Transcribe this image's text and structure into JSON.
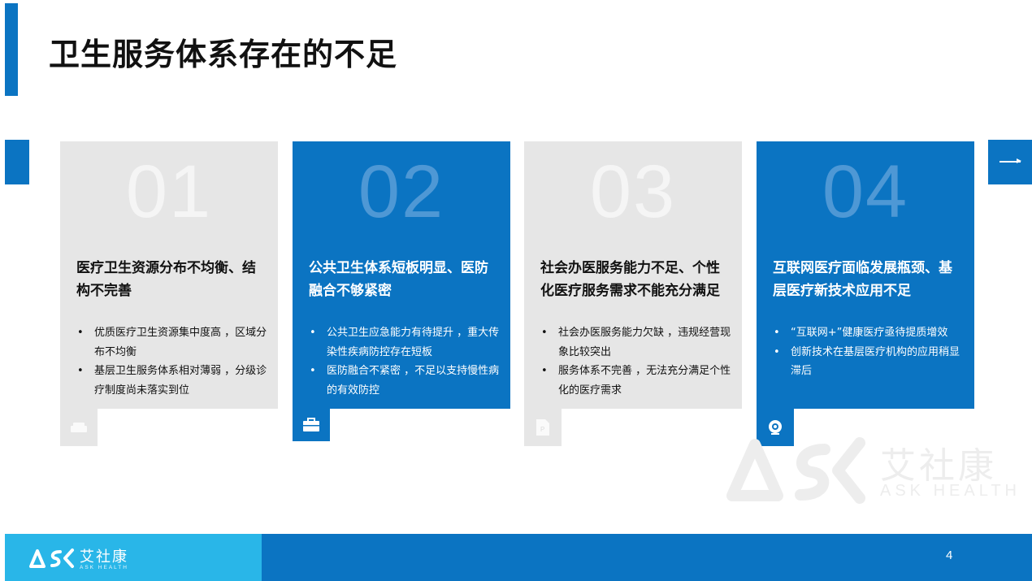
{
  "title": "卫生服务体系存在的不足",
  "cards": [
    {
      "number": "01",
      "title": "医疗卫生资源分布不均衡、结构不完善",
      "bullets": [
        "优质医疗卫生资源集中度高 ，区域分布不均衡",
        "基层卫生服务体系相对薄弱 ，分级诊疗制度尚未落实到位"
      ],
      "icon": "sofa-icon",
      "style": "gray"
    },
    {
      "number": "02",
      "title": "公共卫生体系短板明显、医防融合不够紧密",
      "bullets": [
        "公共卫生应急能力有待提升 ，重大传染性疾病防控存在短板",
        "医防融合不紧密 ，不足以支持慢性病的有效防控"
      ],
      "icon": "briefcase-icon",
      "style": "blue"
    },
    {
      "number": "03",
      "title": "社会办医服务能力不足、个性化医疗服务需求不能充分满足",
      "bullets": [
        "社会办医服务能力欠缺 ，违规经营现象比较突出",
        "服务体系不完善 ，无法充分满足个性化的医疗需求"
      ],
      "icon": "document-icon",
      "style": "gray"
    },
    {
      "number": "04",
      "title": "互联网医疗面临发展瓶颈、基层医疗新技术应用不足",
      "bullets": [
        "“互联网+”健康医疗亟待提质增效",
        "创新技术在基层医疗机构的应用稍显滞后"
      ],
      "icon": "webcam-icon",
      "style": "blue"
    }
  ],
  "watermark": {
    "cn": "艾社康",
    "en": "ASK HEALTH"
  },
  "footer": {
    "logo_cn": "艾社康",
    "logo_en": "ASK HEALTH",
    "page": "4"
  },
  "colors": {
    "primary": "#0b74c2",
    "light_blue": "#29b6e8",
    "card_gray": "#e6e6e6"
  }
}
